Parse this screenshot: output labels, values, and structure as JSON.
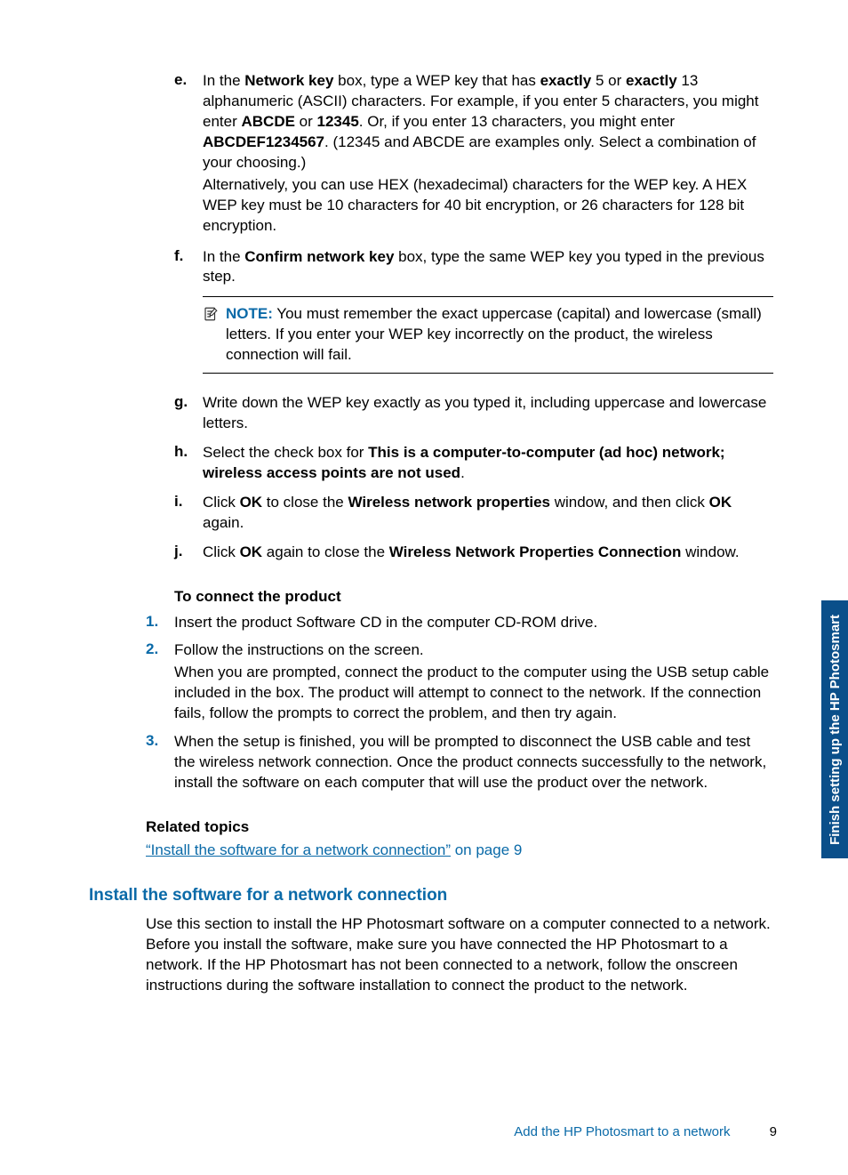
{
  "steps_alpha": {
    "e": {
      "marker": "e.",
      "p1_pre": "In the ",
      "p1_b1": "Network key",
      "p1_mid1": " box, type a WEP key that has ",
      "p1_b2": "exactly",
      "p1_mid2": " 5 or ",
      "p1_b3": "exactly",
      "p1_mid3": " 13 alphanumeric (ASCII) characters. For example, if you enter 5 characters, you might enter ",
      "p1_b4": "ABCDE",
      "p1_mid4": " or ",
      "p1_b5": "12345",
      "p1_mid5": ". Or, if you enter 13 characters, you might enter ",
      "p1_b6": "ABCDEF1234567",
      "p1_tail": ". (12345 and ABCDE are examples only. Select a combination of your choosing.)",
      "p2": "Alternatively, you can use HEX (hexadecimal) characters for the WEP key. A HEX WEP key must be 10 characters for 40 bit encryption, or 26 characters for 128 bit encryption."
    },
    "f": {
      "marker": "f.",
      "pre": "In the ",
      "b1": "Confirm network key",
      "tail": " box, type the same WEP key you typed in the previous step.",
      "note_label": "NOTE:",
      "note_text": " You must remember the exact uppercase (capital) and lowercase (small) letters. If you enter your WEP key incorrectly on the product, the wireless connection will fail."
    },
    "g": {
      "marker": "g.",
      "text": "Write down the WEP key exactly as you typed it, including uppercase and lowercase letters."
    },
    "h": {
      "marker": "h.",
      "pre": "Select the check box for ",
      "b1": "This is a computer-to-computer (ad hoc) network; wireless access points are not used",
      "tail": "."
    },
    "i": {
      "marker": "i.",
      "pre": "Click ",
      "b1": "OK",
      "mid1": " to close the ",
      "b2": "Wireless network properties",
      "mid2": " window, and then click ",
      "b3": "OK",
      "tail": " again."
    },
    "j": {
      "marker": "j.",
      "pre": "Click ",
      "b1": "OK",
      "mid1": " again to close the ",
      "b2": "Wireless Network Properties Connection",
      "tail": " window."
    }
  },
  "connect_heading": "To connect the product",
  "steps_num": {
    "1": {
      "marker": "1.",
      "text": "Insert the product Software CD in the computer CD-ROM drive."
    },
    "2": {
      "marker": "2.",
      "p1": "Follow the instructions on the screen.",
      "p2": "When you are prompted, connect the product to the computer using the USB setup cable included in the box. The product will attempt to connect to the network. If the connection fails, follow the prompts to correct the problem, and then try again."
    },
    "3": {
      "marker": "3.",
      "text": "When the setup is finished, you will be prompted to disconnect the USB cable and test the wireless network connection. Once the product connects successfully to the network, install the software on each computer that will use the product over the network."
    }
  },
  "related_heading": "Related topics",
  "related_link_quoted": "“Install the software for a network connection”",
  "related_link_suffix": " on page 9",
  "h2": "Install the software for a network connection",
  "h2_para": "Use this section to install the HP Photosmart software on a computer connected to a network. Before you install the software, make sure you have connected the HP Photosmart to a network. If the HP Photosmart has not been connected to a network, follow the onscreen instructions during the software installation to connect the product to the network.",
  "side_tab": "Finish setting up the HP Photosmart",
  "footer_text": "Add the HP Photosmart to a network",
  "footer_page": "9"
}
